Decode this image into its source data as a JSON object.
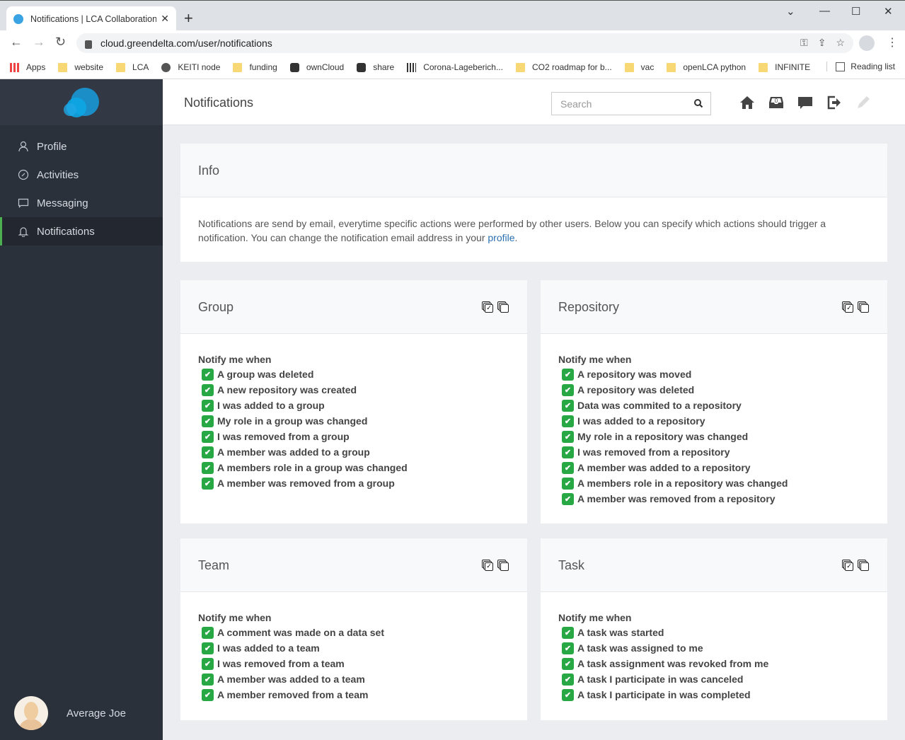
{
  "browser": {
    "tab_title": "Notifications | LCA Collaboration",
    "url": "cloud.greendelta.com/user/notifications",
    "bookmarks": [
      {
        "label": "Apps",
        "icon": "apps"
      },
      {
        "label": "website",
        "icon": "folder"
      },
      {
        "label": "LCA",
        "icon": "folder"
      },
      {
        "label": "KEITI node",
        "icon": "globe"
      },
      {
        "label": "funding",
        "icon": "folder"
      },
      {
        "label": "ownCloud",
        "icon": "cloud"
      },
      {
        "label": "share",
        "icon": "cloud"
      },
      {
        "label": "Corona-Lageberich...",
        "icon": "bars"
      },
      {
        "label": "CO2 roadmap for b...",
        "icon": "folder"
      },
      {
        "label": "vac",
        "icon": "folder"
      },
      {
        "label": "openLCA python",
        "icon": "folder"
      },
      {
        "label": "INFINITE",
        "icon": "folder"
      }
    ],
    "reading_list": "Reading list"
  },
  "sidebar": {
    "items": [
      {
        "label": "Profile",
        "icon": "user-icon",
        "active": false
      },
      {
        "label": "Activities",
        "icon": "gauge-icon",
        "active": false
      },
      {
        "label": "Messaging",
        "icon": "message-icon",
        "active": false
      },
      {
        "label": "Notifications",
        "icon": "bell-icon",
        "active": true
      }
    ],
    "user_name": "Average Joe",
    "accent": "#4caf50"
  },
  "header": {
    "title": "Notifications",
    "search_placeholder": "Search",
    "inbox_count": "0"
  },
  "info": {
    "title": "Info",
    "text": "Notifications are send by email, everytime specific actions were performed by other users. Below you can specify which actions should trigger a notification. You can change the notification email address in your ",
    "link": "profile",
    "suffix": "."
  },
  "sections": {
    "group": {
      "title": "Group",
      "label": "Notify me when",
      "options": [
        "A group was deleted",
        "A new repository was created",
        "I was added to a group",
        "My role in a group was changed",
        "I was removed from a group",
        "A member was added to a group",
        "A members role in a group was changed",
        "A member was removed from a group"
      ]
    },
    "repository": {
      "title": "Repository",
      "label": "Notify me when",
      "options": [
        "A repository was moved",
        "A repository was deleted",
        "Data was commited to a repository",
        "I was added to a repository",
        "My role in a repository was changed",
        "I was removed from a repository",
        "A member was added to a repository",
        "A members role in a repository was changed",
        "A member was removed from a repository"
      ]
    },
    "team": {
      "title": "Team",
      "label": "Notify me when",
      "options": [
        "A comment was made on a data set",
        "I was added to a team",
        "I was removed from a team",
        "A member was added to a team",
        "A member removed from a team"
      ]
    },
    "task": {
      "title": "Task",
      "label": "Notify me when",
      "options": [
        "A task was started",
        "A task was assigned to me",
        "A task assignment was revoked from me",
        "A task I participate in was canceled",
        "A task I participate in was completed"
      ]
    }
  },
  "checkbox_color": "#28a745"
}
